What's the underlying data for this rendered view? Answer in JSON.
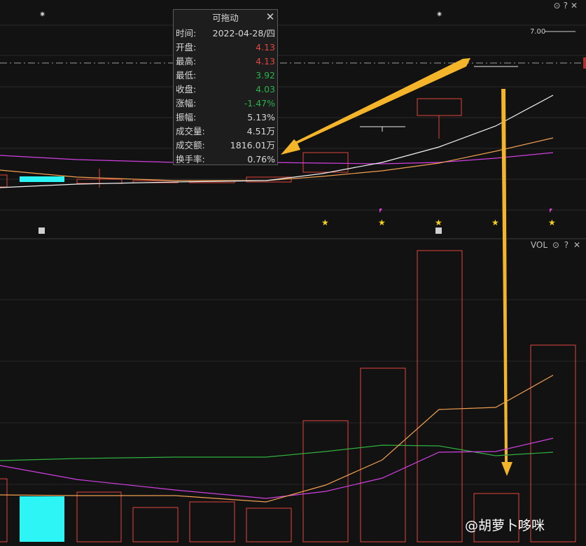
{
  "tooltip": {
    "title": "可拖动",
    "rows": [
      {
        "label": "时间:",
        "value": "2022-04-28/四",
        "color": "#d8d8d8"
      },
      {
        "label": "开盘:",
        "value": "4.13",
        "color": "#e0463c"
      },
      {
        "label": "最高:",
        "value": "4.13",
        "color": "#e0463c"
      },
      {
        "label": "最低:",
        "value": "3.92",
        "color": "#27b34a"
      },
      {
        "label": "收盘:",
        "value": "4.03",
        "color": "#27b34a"
      },
      {
        "label": "涨幅:",
        "value": "-1.47%",
        "color": "#27b34a"
      },
      {
        "label": "振幅:",
        "value": "5.13%",
        "color": "#d8d8d8"
      },
      {
        "label": "成交量:",
        "value": "4.51万",
        "color": "#d8d8d8"
      },
      {
        "label": "成交额:",
        "value": "1816.01万",
        "color": "#d8d8d8"
      },
      {
        "label": "换手率:",
        "value": "0.76%",
        "color": "#d8d8d8"
      }
    ]
  },
  "price_panel": {
    "price_label": "7.00",
    "markers": [
      "☀",
      "☀"
    ]
  },
  "volume_panel": {
    "label": "VOL"
  },
  "watermark": "@胡萝卜哆咪",
  "colors": {
    "background": "#121212",
    "up": "#e0463c",
    "down": "#2ef5f5",
    "arrow": "#f5b52a",
    "ma_white": "#ffffff",
    "ma_orange": "#f0a050",
    "ma_magenta": "#d040e0",
    "ma_green": "#30b040",
    "star": "#f5d020"
  }
}
